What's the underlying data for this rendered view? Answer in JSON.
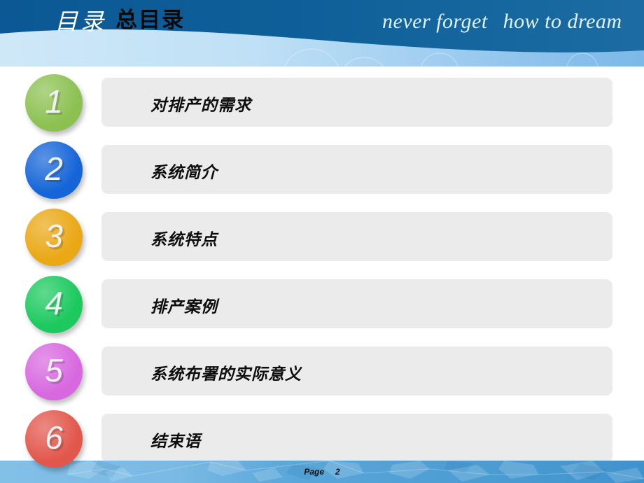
{
  "slide": {
    "header": {
      "title_decor": "目录",
      "title": "总目录",
      "tagline_left": "never forget",
      "tagline_right": "how to dream",
      "band_color": "#0d5d9a",
      "band_color_dark": "#115f94",
      "underband_color": "#bfe0f4"
    },
    "agenda": {
      "items": [
        {
          "number": "1",
          "label": "对排产的需求",
          "color": "#8cc152"
        },
        {
          "number": "2",
          "label": "系统简介",
          "color": "#1565d8"
        },
        {
          "number": "3",
          "label": "系统特点",
          "color": "#eaa815"
        },
        {
          "number": "4",
          "label": "排产案例",
          "color": "#1bc95e"
        },
        {
          "number": "5",
          "label": "系统布署的实际意义",
          "color": "#d868e0"
        },
        {
          "number": "6",
          "label": "结束语",
          "color": "#e2574c"
        }
      ],
      "bar_color": "#ebebeb"
    },
    "footer": {
      "page_label": "Page",
      "page_number": "2",
      "band_color": "#4a9ad0"
    }
  }
}
